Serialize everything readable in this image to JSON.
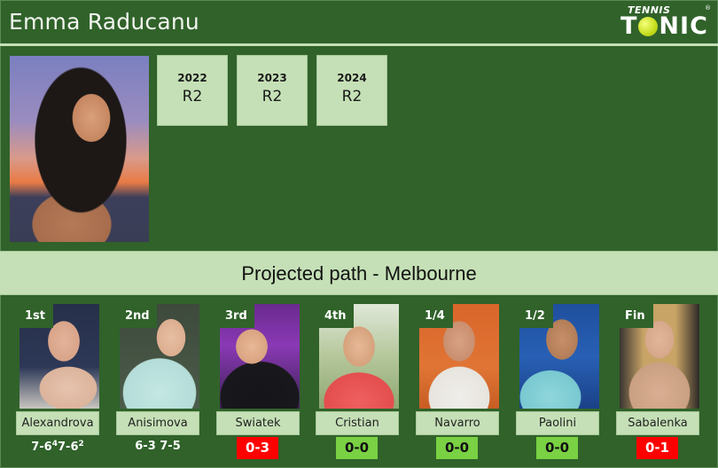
{
  "header": {
    "title": "Emma Raducanu",
    "logo": {
      "top_text": "TENNIS",
      "main_text_left": "T",
      "main_text_right": "NIC",
      "registered": "®"
    }
  },
  "player_photo": {
    "alt": "Emma Raducanu portrait"
  },
  "history": [
    {
      "year": "2022",
      "result": "R2"
    },
    {
      "year": "2023",
      "result": "R2"
    },
    {
      "year": "2024",
      "result": "R2"
    }
  ],
  "path_banner": {
    "title": "Projected path - Melbourne"
  },
  "opponents": [
    {
      "round": "1st",
      "name": "Alexandrova",
      "score_parts": [
        "7-6",
        "4",
        "7-6",
        "2"
      ],
      "result_type": "score"
    },
    {
      "round": "2nd",
      "name": "Anisimova",
      "score": "6-3 7-5",
      "result_type": "score"
    },
    {
      "round": "3rd",
      "name": "Swiatek",
      "h2h": "0-3",
      "result_type": "loss"
    },
    {
      "round": "4th",
      "name": "Cristian",
      "h2h": "0-0",
      "result_type": "even"
    },
    {
      "round": "1/4",
      "name": "Navarro",
      "h2h": "0-0",
      "result_type": "even"
    },
    {
      "round": "1/2",
      "name": "Paolini",
      "h2h": "0-0",
      "result_type": "even"
    },
    {
      "round": "Fin",
      "name": "Sabalenka",
      "h2h": "0-1",
      "result_type": "loss"
    }
  ],
  "colors": {
    "background": "#30622a",
    "light_green": "#c5e0b6",
    "loss_red": "#ff0000",
    "even_green": "#79d143"
  }
}
